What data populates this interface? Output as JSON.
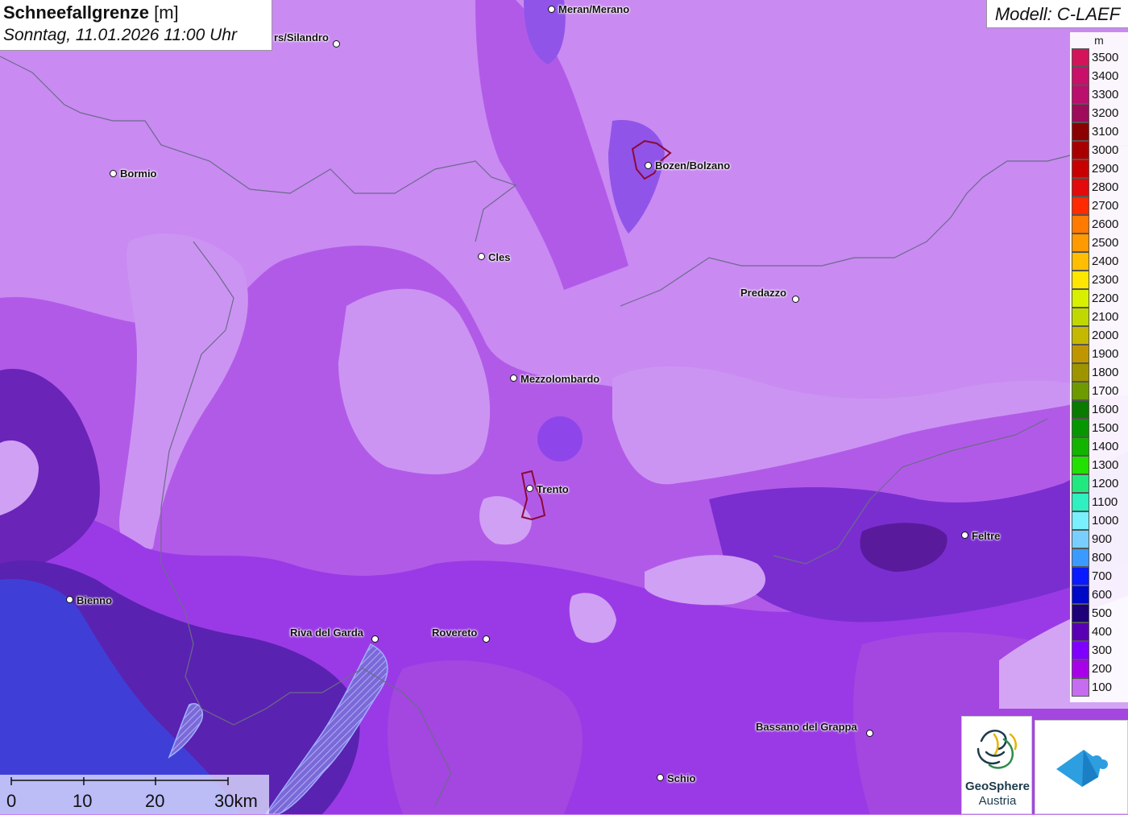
{
  "title": {
    "parameter": "Schneefallgrenze",
    "unit": "[m]",
    "datetime": "Sonntag, 11.01.2026 11:00 Uhr"
  },
  "model": "Modell: C-LAEF",
  "legend": {
    "unit": "m",
    "entries": [
      {
        "label": "3500",
        "color": "#d4145a"
      },
      {
        "label": "3400",
        "color": "#c8106a"
      },
      {
        "label": "3300",
        "color": "#bb0f6e"
      },
      {
        "label": "3200",
        "color": "#9e0b5a"
      },
      {
        "label": "3100",
        "color": "#8b0000"
      },
      {
        "label": "3000",
        "color": "#a80000"
      },
      {
        "label": "2900",
        "color": "#c80000"
      },
      {
        "label": "2800",
        "color": "#e20a0a"
      },
      {
        "label": "2700",
        "color": "#ff2a00"
      },
      {
        "label": "2600",
        "color": "#ff7a00"
      },
      {
        "label": "2500",
        "color": "#ff9a00"
      },
      {
        "label": "2400",
        "color": "#ffbe00"
      },
      {
        "label": "2300",
        "color": "#ffe600"
      },
      {
        "label": "2200",
        "color": "#d8f000"
      },
      {
        "label": "2100",
        "color": "#c0d800"
      },
      {
        "label": "2000",
        "color": "#c4b800"
      },
      {
        "label": "1900",
        "color": "#c09600"
      },
      {
        "label": "1800",
        "color": "#9e9400"
      },
      {
        "label": "1700",
        "color": "#6e9a00"
      },
      {
        "label": "1600",
        "color": "#0a7a00"
      },
      {
        "label": "1500",
        "color": "#069600"
      },
      {
        "label": "1400",
        "color": "#12b400"
      },
      {
        "label": "1300",
        "color": "#22e000"
      },
      {
        "label": "1200",
        "color": "#22e880"
      },
      {
        "label": "1100",
        "color": "#2ef0c0"
      },
      {
        "label": "1000",
        "color": "#7af0ff"
      },
      {
        "label": "900",
        "color": "#78cfff"
      },
      {
        "label": "800",
        "color": "#3a9aff"
      },
      {
        "label": "700",
        "color": "#0a1aff"
      },
      {
        "label": "600",
        "color": "#0008c8"
      },
      {
        "label": "500",
        "color": "#1e0078"
      },
      {
        "label": "400",
        "color": "#5a00b4"
      },
      {
        "label": "300",
        "color": "#8000ff"
      },
      {
        "label": "200",
        "color": "#a800e8"
      },
      {
        "label": "100",
        "color": "#c56cf0"
      }
    ]
  },
  "cities": [
    {
      "name": "Meran/Merano"
    },
    {
      "name": "rs/Silandro"
    },
    {
      "name": "Bormio"
    },
    {
      "name": "Bozen/Bolzano"
    },
    {
      "name": "Cles"
    },
    {
      "name": "Predazzo"
    },
    {
      "name": "Mezzolombardo"
    },
    {
      "name": "Trento"
    },
    {
      "name": "Feltre"
    },
    {
      "name": "Bienno"
    },
    {
      "name": "Riva del Garda"
    },
    {
      "name": "Rovereto"
    },
    {
      "name": "Bassano del Grappa"
    },
    {
      "name": "Schio"
    }
  ],
  "scalebar": {
    "labels": [
      "0",
      "10",
      "20",
      "30km"
    ]
  },
  "logos": {
    "geosphere_name": "GeoSphere",
    "geosphere_sub": "Austria"
  }
}
